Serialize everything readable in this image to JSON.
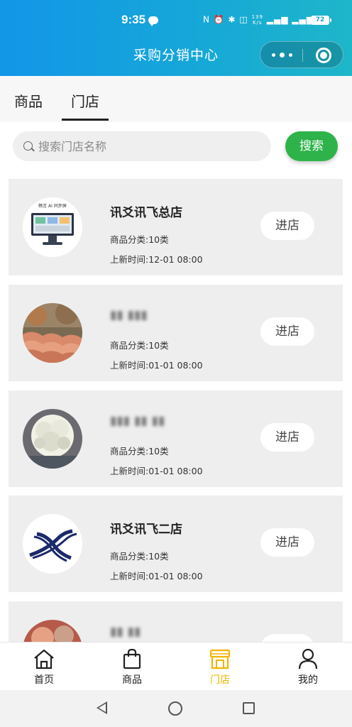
{
  "status_bar": {
    "time": "9:35",
    "speed_top": "139",
    "speed_bottom": "K/s",
    "battery": "72",
    "icons_text": "N ⏰ ✱ ◫ "
  },
  "header": {
    "title": "采购分销中心"
  },
  "tabs": [
    {
      "label": "商品",
      "active": false
    },
    {
      "label": "门店",
      "active": true
    }
  ],
  "search": {
    "placeholder": "搜索门店名称",
    "button_label": "搜索"
  },
  "stores": [
    {
      "name": "讯爻讯飞总店",
      "category": "商品分类:10类",
      "updated": "上新时间:12-01 08:00",
      "enter_label": "进店",
      "name_blurred": false,
      "avatar": "tablet"
    },
    {
      "name": "▮▮ ▮▮▮",
      "category": "商品分类:10类",
      "updated": "上新时间:01-01 08:00",
      "enter_label": "进店",
      "name_blurred": true,
      "avatar": "tiles"
    },
    {
      "name": "▮▮▮ ▮▮ ▮▮",
      "category": "商品分类:10类",
      "updated": "上新时间:01-01 08:00",
      "enter_label": "进店",
      "name_blurred": true,
      "avatar": "flower"
    },
    {
      "name": "讯爻讯飞二店",
      "category": "商品分类:10类",
      "updated": "上新时间:01-01 08:00",
      "enter_label": "进店",
      "name_blurred": false,
      "avatar": "logo"
    },
    {
      "name": "▮▮ ▮▮",
      "category": "",
      "updated": "",
      "enter_label": "",
      "name_blurred": true,
      "avatar": "food"
    }
  ],
  "bottom_nav": [
    {
      "label": "首页",
      "icon": "home-icon",
      "active": false
    },
    {
      "label": "商品",
      "icon": "bag-icon",
      "active": false
    },
    {
      "label": "门店",
      "icon": "store-icon",
      "active": true
    },
    {
      "label": "我的",
      "icon": "user-icon",
      "active": false
    }
  ],
  "colors": {
    "header_start": "#1296e8",
    "header_end": "#1eb6c9",
    "search_button": "#2db34a",
    "active_nav": "#f0b400"
  }
}
